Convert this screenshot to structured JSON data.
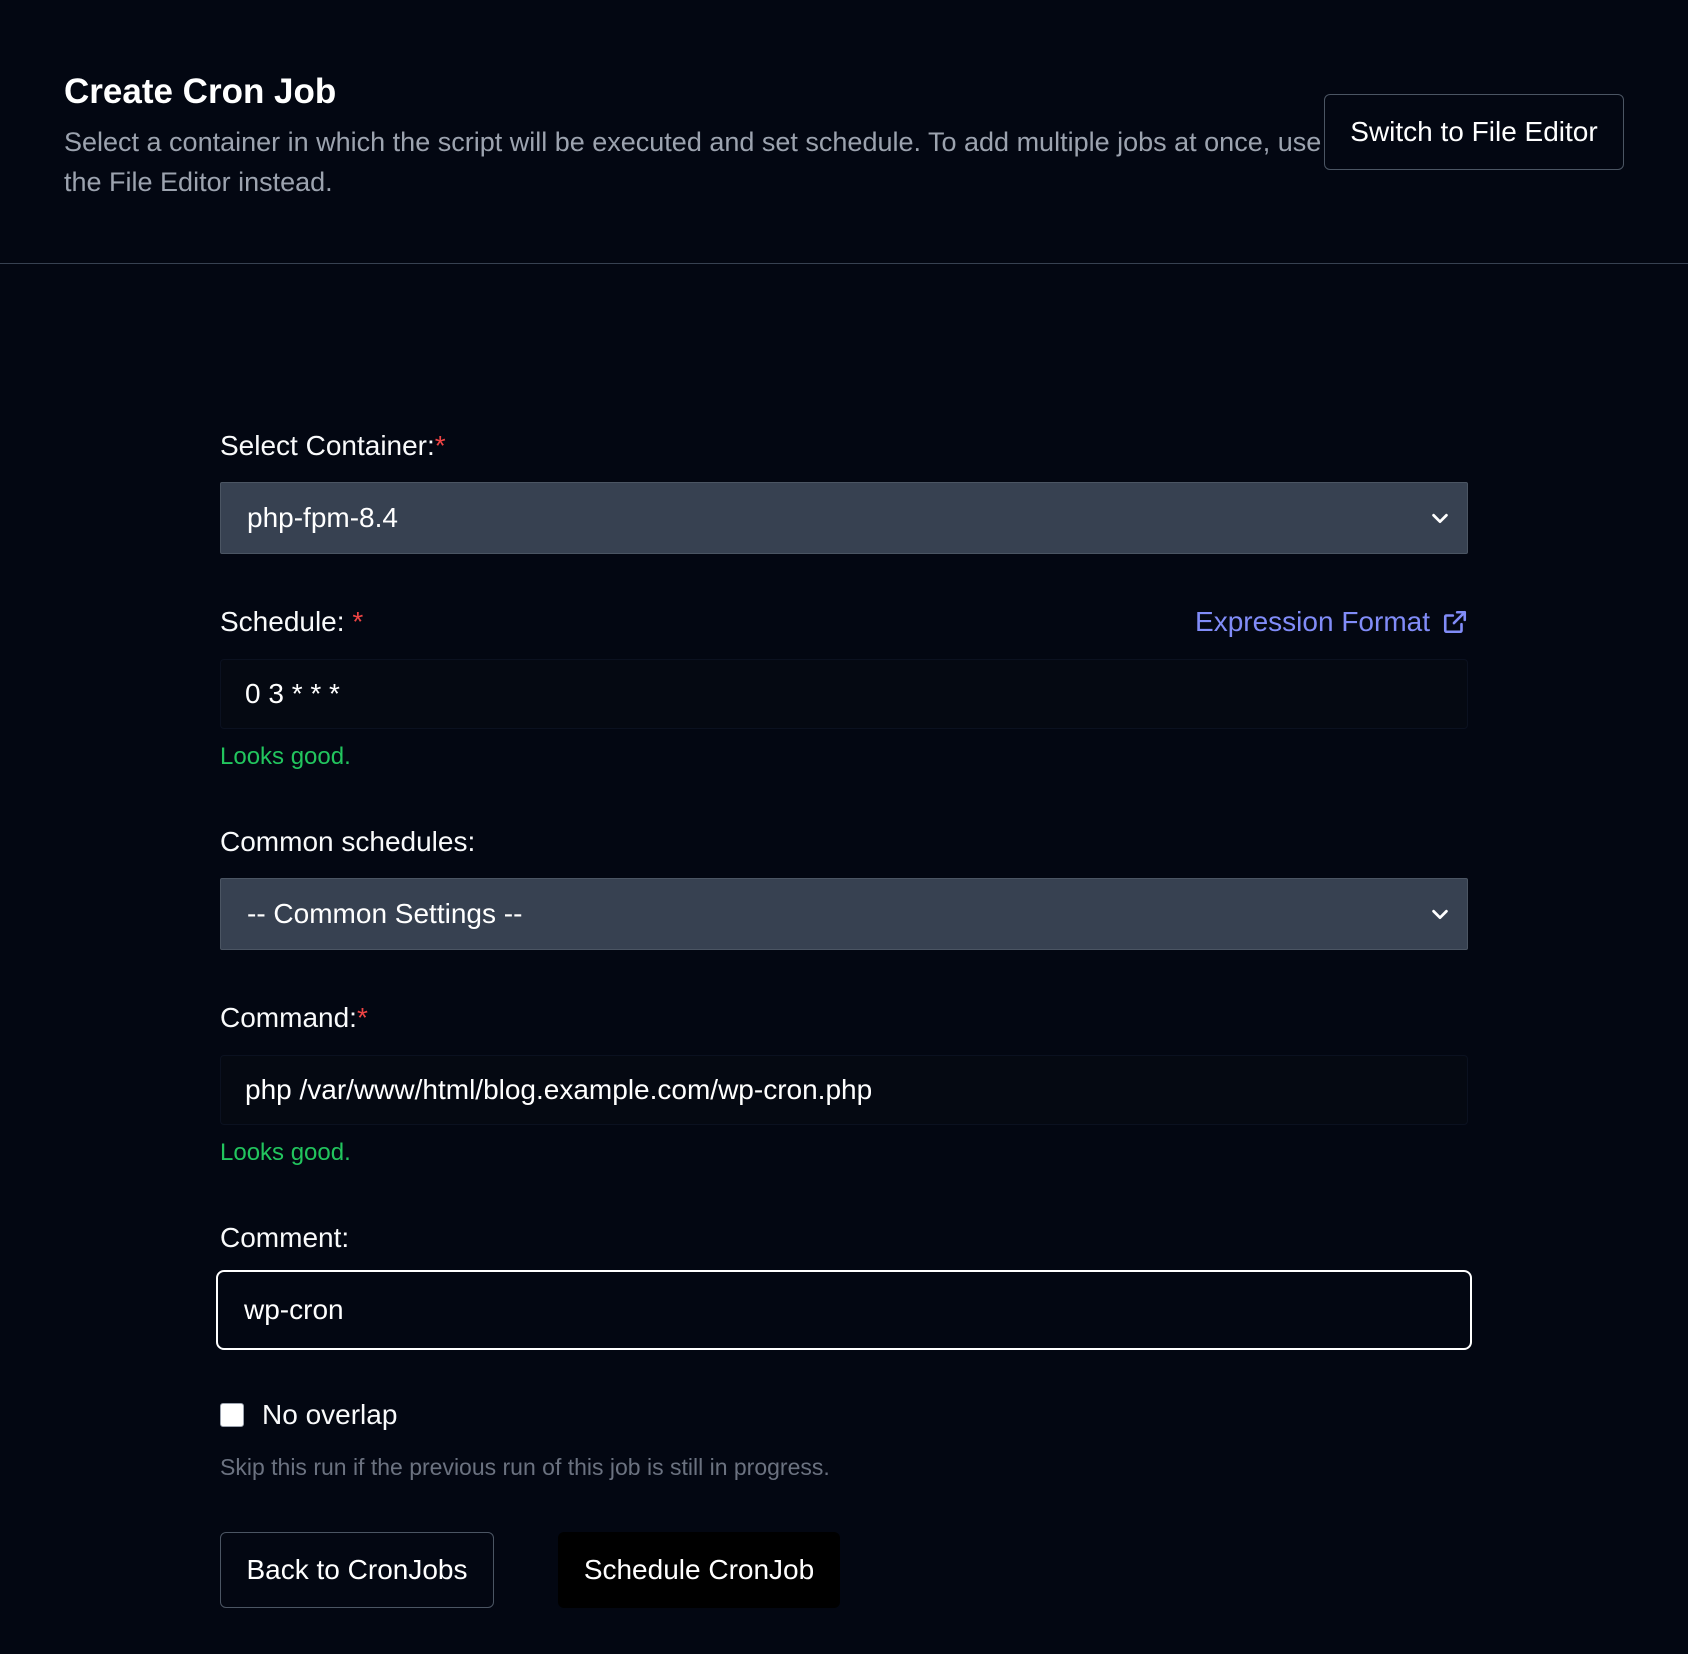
{
  "header": {
    "title": "Create Cron Job",
    "description": "Select a container in which the script will be executed and set schedule. To add multiple jobs at once, use the File Editor instead.",
    "switch_label": "Switch to File Editor"
  },
  "form": {
    "container": {
      "label": "Select Container:",
      "required_mark": "*",
      "selected": "php-fpm-8.4",
      "icon": "chevron-down-icon"
    },
    "schedule": {
      "label": "Schedule:",
      "required_mark": "*",
      "value": "0 3 * * *",
      "validation": "Looks good.",
      "help_link": "Expression Format",
      "help_icon": "external-link-icon"
    },
    "common_schedules": {
      "label": "Common schedules:",
      "selected": "-- Common Settings --",
      "icon": "chevron-down-icon"
    },
    "command": {
      "label": "Command:",
      "required_mark": "*",
      "value": "php /var/www/html/blog.example.com/wp-cron.php",
      "validation": "Looks good."
    },
    "comment": {
      "label": "Comment:",
      "value": "wp-cron"
    },
    "no_overlap": {
      "label": "No overlap",
      "checked": false,
      "hint": "Skip this run if the previous run of this job is still in progress."
    }
  },
  "actions": {
    "back_label": "Back to CronJobs",
    "submit_label": "Schedule CronJob"
  },
  "colors": {
    "background": "#030712",
    "required": "#ef4444",
    "valid": "#22c55e",
    "link": "#818cf8",
    "select_bg": "#374151"
  }
}
